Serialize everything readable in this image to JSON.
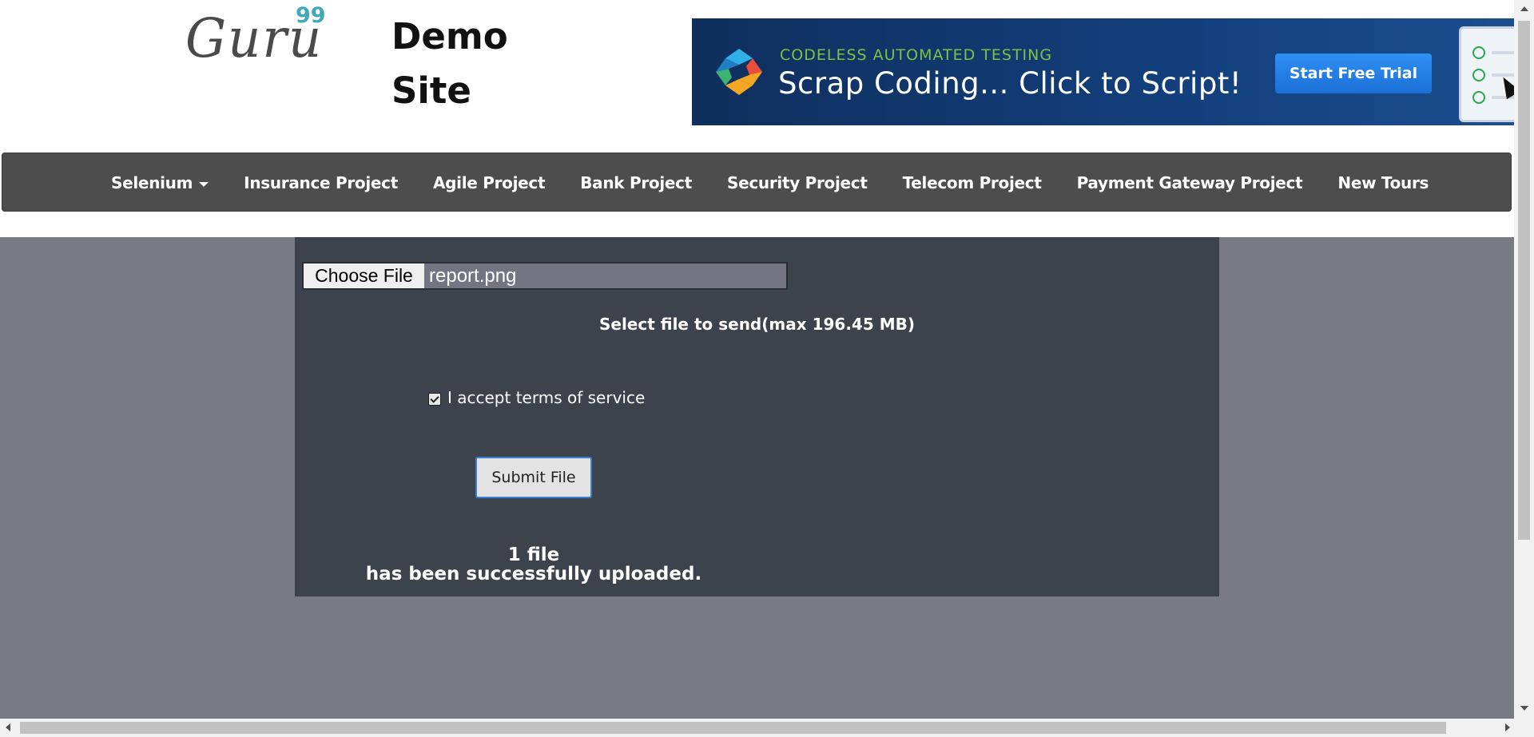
{
  "header": {
    "logo_text": "Guru",
    "logo_superscript": "99",
    "site_title": "Demo Site"
  },
  "banner": {
    "kicker": "CODELESS AUTOMATED TESTING",
    "headline": "Scrap Coding... Click to Script!",
    "cta_label": "Start Free Trial"
  },
  "nav": {
    "items": [
      {
        "label": "Selenium",
        "has_dropdown": true
      },
      {
        "label": "Insurance Project"
      },
      {
        "label": "Agile Project"
      },
      {
        "label": "Bank Project"
      },
      {
        "label": "Security Project"
      },
      {
        "label": "Telecom Project"
      },
      {
        "label": "Payment Gateway Project"
      },
      {
        "label": "New Tours"
      }
    ]
  },
  "upload": {
    "choose_file_label": "Choose File",
    "file_name": "report.png",
    "hint": "Select file to send(max 196.45 MB)",
    "terms_label": "I accept terms of service",
    "terms_checked": true,
    "submit_label": "Submit File",
    "result_line1": "1 file",
    "result_line2": "has been successfully uploaded."
  },
  "colors": {
    "nav_bg": "#4d4d4d",
    "panel_bg": "#3d434c",
    "page_bg": "#787b86",
    "banner_bg": "#123e7a",
    "accent_green": "#7dc242",
    "logo_accent": "#3ea9b9"
  }
}
